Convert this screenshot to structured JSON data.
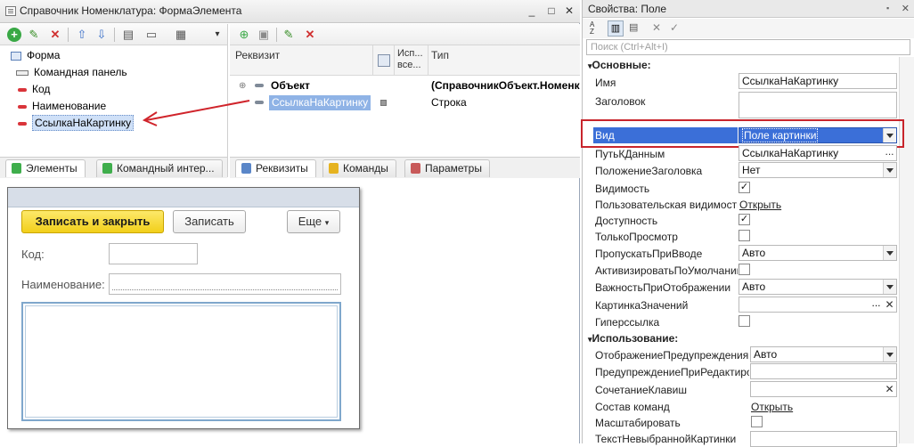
{
  "left_window": {
    "title": "Справочник Номенклатура: ФормаЭлемента",
    "controls": {
      "minimize": "_",
      "maximize": "□",
      "close": "✕"
    }
  },
  "elements_tree": {
    "items": [
      {
        "label": "Форма",
        "icon": "form-icon"
      },
      {
        "label": "Командная панель",
        "icon": "command-panel-icon"
      },
      {
        "label": "Код",
        "icon": "field-icon"
      },
      {
        "label": "Наименование",
        "icon": "field-icon"
      },
      {
        "label": "СсылкаНаКартинку",
        "icon": "field-icon",
        "selected": true
      }
    ],
    "tabs": [
      "Элементы",
      "Командный интер..."
    ]
  },
  "attributes": {
    "columns": {
      "requisite": "Реквизит",
      "use_all": "Исп... все...",
      "type": "Тип"
    },
    "rows": [
      {
        "name": "Объект",
        "type": "(СправочникОбъект.Номенк"
      },
      {
        "name": "СсылкаНаКартинку",
        "type": "Строка"
      }
    ],
    "tabs": [
      "Реквизиты",
      "Команды",
      "Параметры"
    ]
  },
  "form_preview": {
    "save_close": "Записать и закрыть",
    "save": "Записать",
    "more": "Еще",
    "code_label": "Код:",
    "name_label": "Наименование:"
  },
  "properties": {
    "title": "Свойства: Поле",
    "search_placeholder": "Поиск (Ctrl+Alt+I)",
    "section_basic": "Основные:",
    "section_usage": "Использование:",
    "rows": {
      "name": {
        "label": "Имя",
        "value": "СсылкаНаКартинку"
      },
      "header": {
        "label": "Заголовок",
        "value": ""
      },
      "view": {
        "label": "Вид",
        "value": "Поле картинки"
      },
      "datapath": {
        "label": "ПутьКДанным",
        "value": "СсылкаНаКартинку"
      },
      "titlepos": {
        "label": "ПоложениеЗаголовка",
        "value": "Нет"
      },
      "visible": {
        "label": "Видимость",
        "checked": true
      },
      "uservis": {
        "label": "Пользовательская видимость",
        "link": "Открыть"
      },
      "enabled": {
        "label": "Доступность",
        "checked": true
      },
      "readonly": {
        "label": "ТолькоПросмотр",
        "checked": false
      },
      "skip": {
        "label": "ПропускатьПриВводе",
        "value": "Авто"
      },
      "activate": {
        "label": "АктивизироватьПоУмолчанию",
        "checked": false
      },
      "importance": {
        "label": "ВажностьПриОтображении",
        "value": "Авто"
      },
      "valpic": {
        "label": "КартинкаЗначений",
        "value": ""
      },
      "hyperlink": {
        "label": "Гиперссылка",
        "checked": false
      },
      "warnshow": {
        "label": "ОтображениеПредупрежденияПри",
        "value": "Авто"
      },
      "warnedit": {
        "label": "ПредупреждениеПриРедактирова",
        "value": ""
      },
      "hotkey": {
        "label": "СочетаниеКлавиш",
        "value": ""
      },
      "commands": {
        "label": "Состав команд",
        "link": "Открыть"
      },
      "scale": {
        "label": "Масштабировать",
        "checked": false
      },
      "unselected": {
        "label": "ТекстНевыбраннойКартинки",
        "value": ""
      }
    }
  },
  "colors": {
    "highlight": "#3b6fd8",
    "annotation": "#d0242b",
    "primary_button": "#f5d52a"
  }
}
